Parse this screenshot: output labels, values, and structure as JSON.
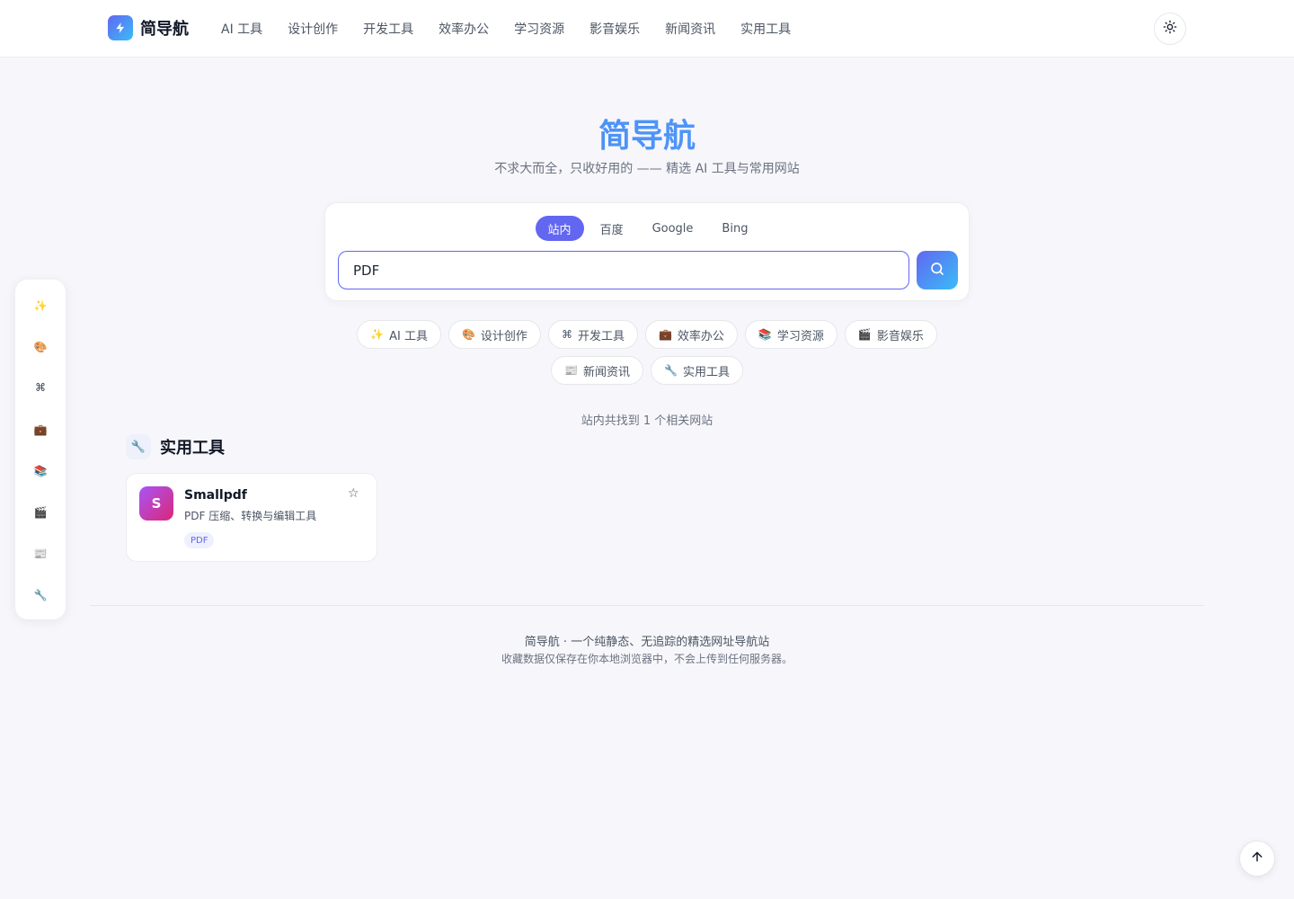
{
  "header": {
    "logo_text": "简导航",
    "nav": [
      "AI 工具",
      "设计创作",
      "开发工具",
      "效率办公",
      "学习资源",
      "影音娱乐",
      "新闻资讯",
      "实用工具"
    ]
  },
  "hero": {
    "title": "简导航",
    "subtitle": "不求大而全，只收好用的 —— 精选 AI 工具与常用网站"
  },
  "search": {
    "engines": [
      "站内",
      "百度",
      "Google",
      "Bing"
    ],
    "active_engine": "站内",
    "value": "PDF"
  },
  "categories": [
    {
      "icon": "✨",
      "label": "AI 工具"
    },
    {
      "icon": "🎨",
      "label": "设计创作"
    },
    {
      "icon": "⌘",
      "label": "开发工具"
    },
    {
      "icon": "💼",
      "label": "效率办公"
    },
    {
      "icon": "📚",
      "label": "学习资源"
    },
    {
      "icon": "🎬",
      "label": "影音娱乐"
    },
    {
      "icon": "📰",
      "label": "新闻资讯"
    },
    {
      "icon": "🔧",
      "label": "实用工具"
    }
  ],
  "results": {
    "count_text": "站内共找到 1 个相关网站",
    "section": {
      "icon": "🔧",
      "title": "实用工具"
    },
    "site": {
      "initial": "S",
      "name": "Smallpdf",
      "desc": "PDF 压缩、转换与编辑工具",
      "tag": "PDF",
      "star": "☆"
    }
  },
  "side_dock": [
    "✨",
    "🎨",
    "⌘",
    "💼",
    "📚",
    "🎬",
    "📰",
    "🔧"
  ],
  "footer": {
    "line1": "简导航 · 一个纯静态、无追踪的精选网址导航站",
    "line2": "收藏数据仅保存在你本地浏览器中，不会上传到任何服务器。"
  },
  "colors": {
    "accent": "#6366f1",
    "accent_light": "#38bdf8",
    "title_blue": "#3b82f6"
  }
}
